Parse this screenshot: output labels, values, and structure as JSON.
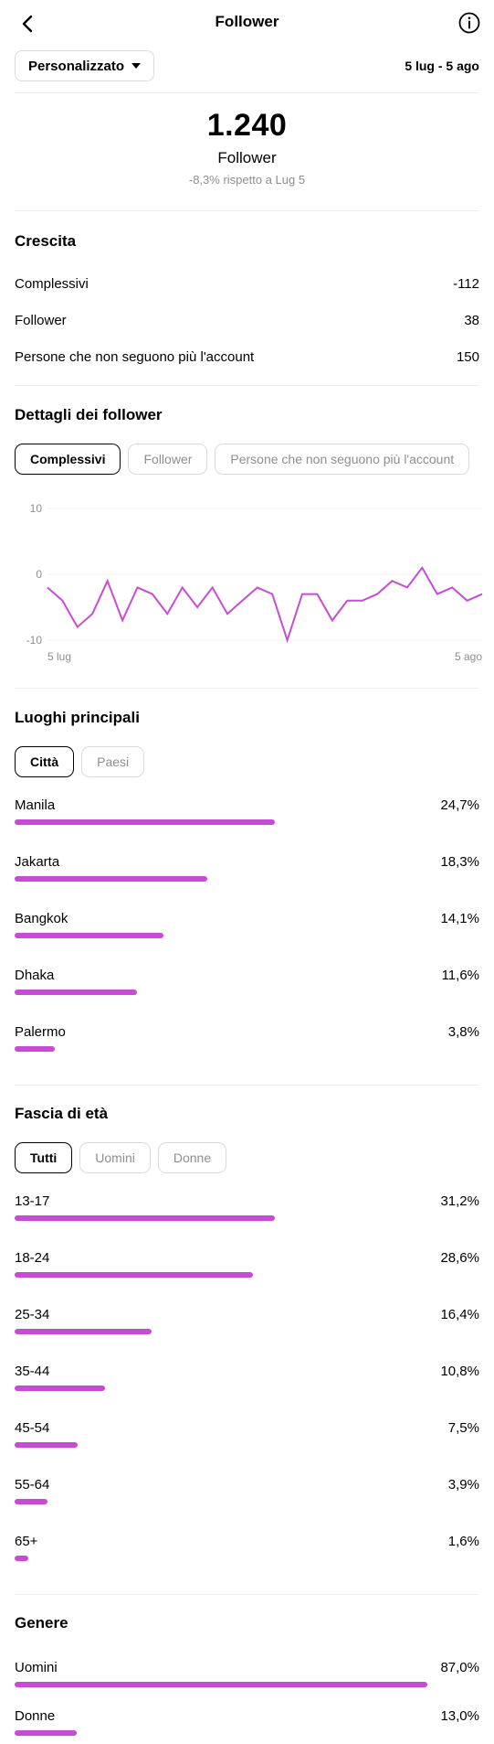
{
  "header": {
    "title": "Follower"
  },
  "range": {
    "dropdown_label": "Personalizzato",
    "dates": "5 lug - 5 ago"
  },
  "summary": {
    "count": "1.240",
    "label": "Follower",
    "change": "-8,3% rispetto a Lug 5"
  },
  "growth": {
    "title": "Crescita",
    "rows": [
      {
        "label": "Complessivi",
        "value": "-112"
      },
      {
        "label": "Follower",
        "value": "38"
      },
      {
        "label": "Persone che non seguono più l'account",
        "value": "150"
      }
    ]
  },
  "details": {
    "title": "Dettagli dei follower",
    "tabs": [
      "Complessivi",
      "Follower",
      "Persone che non seguono più l'account"
    ],
    "active_tab": 0
  },
  "chart_data": {
    "type": "line",
    "x_start_label": "5 lug",
    "x_end_label": "5 ago",
    "yticks": [
      "10",
      "0",
      "-10"
    ],
    "ylim": [
      -10,
      10
    ],
    "grid": true,
    "color": "#c84bd6",
    "series": [
      {
        "values": [
          -2,
          -4,
          -8,
          -6,
          -1,
          -7,
          -2,
          -3,
          -6,
          -2,
          -5,
          -2,
          -6,
          -4,
          -2,
          -3,
          -10,
          -3,
          -3,
          -7,
          -4,
          -4,
          -3,
          -1,
          -2,
          1,
          -3,
          -2,
          -4,
          -3
        ]
      }
    ]
  },
  "locations": {
    "title": "Luoghi principali",
    "tabs": [
      "Città",
      "Paesi"
    ],
    "active_tab": 0,
    "items": [
      {
        "label": "Manila",
        "value": "24,7%",
        "pct": 24.7
      },
      {
        "label": "Jakarta",
        "value": "18,3%",
        "pct": 18.3
      },
      {
        "label": "Bangkok",
        "value": "14,1%",
        "pct": 14.1
      },
      {
        "label": "Dhaka",
        "value": "11,6%",
        "pct": 11.6
      },
      {
        "label": "Palermo",
        "value": "3,8%",
        "pct": 3.8
      }
    ]
  },
  "age": {
    "title": "Fascia di età",
    "tabs": [
      "Tutti",
      "Uomini",
      "Donne"
    ],
    "active_tab": 0,
    "items": [
      {
        "label": "13-17",
        "value": "31,2%",
        "pct": 31.2
      },
      {
        "label": "18-24",
        "value": "28,6%",
        "pct": 28.6
      },
      {
        "label": "25-34",
        "value": "16,4%",
        "pct": 16.4
      },
      {
        "label": "35-44",
        "value": "10,8%",
        "pct": 10.8
      },
      {
        "label": "45-54",
        "value": "7,5%",
        "pct": 7.5
      },
      {
        "label": "55-64",
        "value": "3,9%",
        "pct": 3.9
      },
      {
        "label": "65+",
        "value": "1,6%",
        "pct": 1.6
      }
    ]
  },
  "gender": {
    "title": "Genere",
    "items": [
      {
        "label": "Uomini",
        "value": "87,0%",
        "pct": 87.0
      },
      {
        "label": "Donne",
        "value": "13,0%",
        "pct": 13.0
      }
    ]
  },
  "colors": {
    "accent": "#c84bd6",
    "muted": "#8e8e8e",
    "border": "#dbdbdb"
  }
}
